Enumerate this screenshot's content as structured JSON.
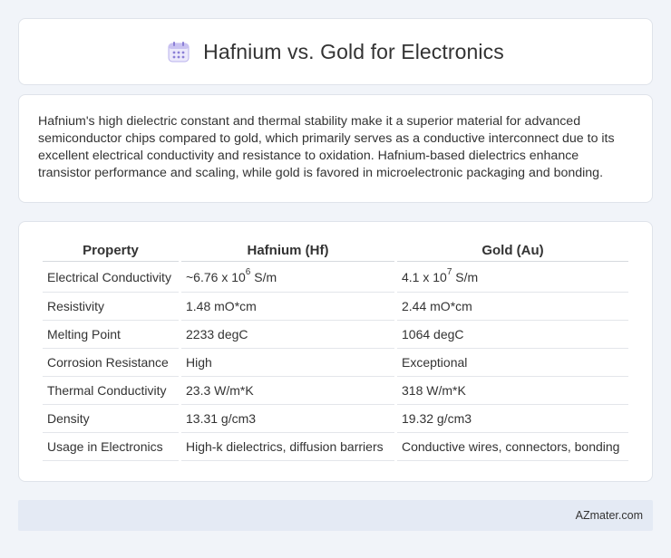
{
  "header": {
    "title": "Hafnium vs. Gold for Electronics",
    "icon": "calendar-icon",
    "icon_color": "#8b7fd6"
  },
  "intro": {
    "text": "Hafnium's high dielectric constant and thermal stability make it a superior material for advanced semiconductor chips compared to gold, which primarily serves as a conductive interconnect due to its excellent electrical conductivity and resistance to oxidation. Hafnium-based dielectrics enhance transistor performance and scaling, while gold is favored in microelectronic packaging and bonding."
  },
  "table": {
    "headers": [
      "Property",
      "Hafnium (Hf)",
      "Gold (Au)"
    ],
    "rows": [
      {
        "property": "Electrical Conductivity",
        "hf_base": "~6.76 x 10",
        "hf_exp": "6",
        "hf_unit": " S/m",
        "au_base": "4.1 x 10",
        "au_exp": "7",
        "au_unit": " S/m"
      },
      {
        "property": "Resistivity",
        "hf": "1.48 mO*cm",
        "au": "2.44 mO*cm"
      },
      {
        "property": "Melting Point",
        "hf": "2233 degC",
        "au": "1064 degC"
      },
      {
        "property": "Corrosion Resistance",
        "hf": "High",
        "au": "Exceptional"
      },
      {
        "property": "Thermal Conductivity",
        "hf": "23.3 W/m*K",
        "au": "318 W/m*K"
      },
      {
        "property": "Density",
        "hf": "13.31 g/cm3",
        "au": "19.32 g/cm3"
      },
      {
        "property": "Usage in Electronics",
        "hf": "High-k dielectrics, diffusion barriers",
        "au": "Conductive wires, connectors, bonding"
      }
    ]
  },
  "footer": {
    "text": "AZmater.com"
  }
}
